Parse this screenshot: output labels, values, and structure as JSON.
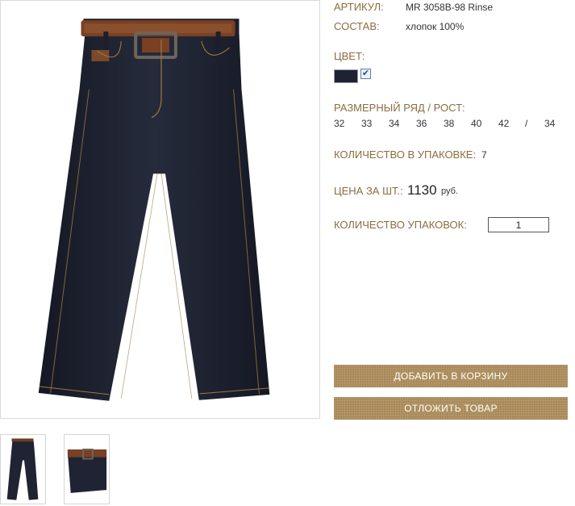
{
  "product": {
    "article_label": "АРТИКУЛ:",
    "article_value": "MR 3058B-98 Rinse",
    "composition_label": "СОСТАВ:",
    "composition_value": "хлопок 100%",
    "color_label": "ЦВЕТ:",
    "color_swatch": "#1e2232",
    "color_selected": true,
    "size_label": "РАЗМЕРНЫЙ РЯД / РОСТ:",
    "sizes": [
      "32",
      "33",
      "34",
      "36",
      "38",
      "40",
      "42",
      "/",
      "34"
    ],
    "pack_label": "КОЛИЧЕСТВО В УПАКОВКЕ:",
    "pack_value": "7",
    "price_label": "ЦЕНА ЗА ШТ.:",
    "price_value": "1130",
    "price_unit": "руб.",
    "qty_label": "КОЛИЧЕСТВО УПАКОВОК:",
    "qty_value": "1"
  },
  "buttons": {
    "add_to_cart": "ДОБАВИТЬ В КОРЗИНУ",
    "defer": "ОТЛОЖИТЬ ТОВАР"
  },
  "colors": {
    "label": "#8b6d3f",
    "button": "#a58450",
    "denim": "#1e2232"
  }
}
